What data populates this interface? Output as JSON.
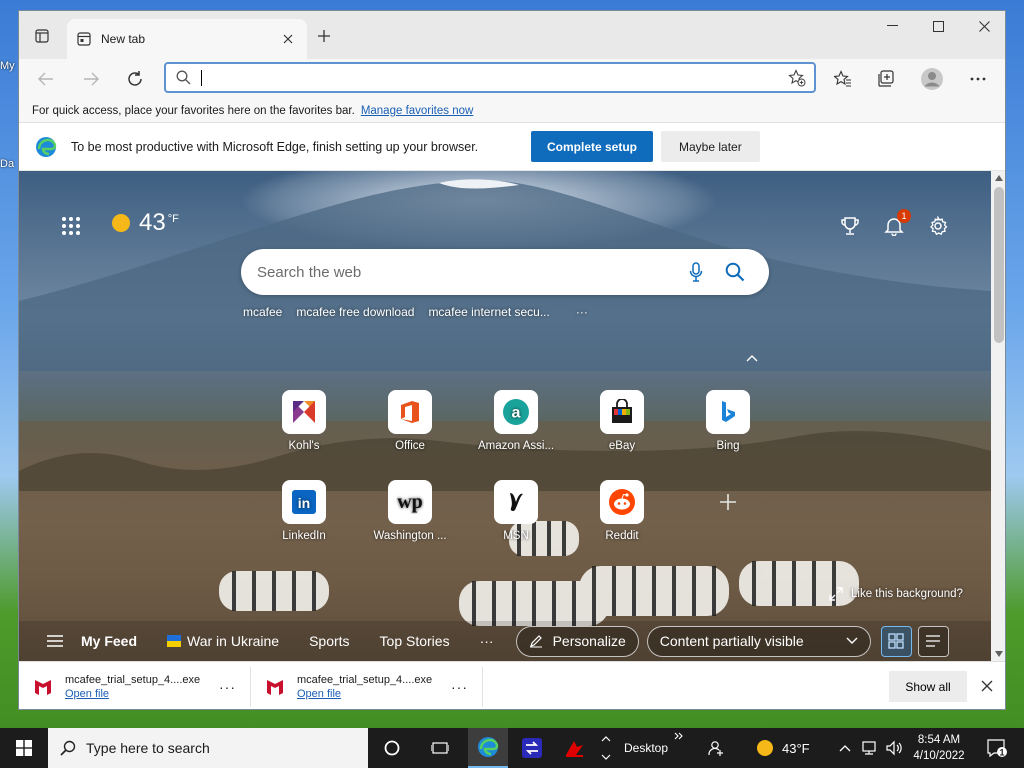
{
  "desktop": {
    "peek_top": "My",
    "peek_bottom": "Da"
  },
  "tab": {
    "title": "New tab"
  },
  "address": {
    "value": "",
    "placeholder": ""
  },
  "favbar": {
    "text": "For quick access, place your favorites here on the favorites bar.",
    "link": "Manage favorites now"
  },
  "setup": {
    "message": "To be most productive with Microsoft Edge, finish setting up your browser.",
    "primary": "Complete setup",
    "secondary": "Maybe later"
  },
  "weather": {
    "temp": "43",
    "unit": "°F"
  },
  "notifications": {
    "count": "1"
  },
  "search": {
    "placeholder": "Search the web",
    "suggestions": [
      "mcafee",
      "mcafee free download",
      "mcafee internet secu...",
      "···"
    ]
  },
  "tiles": [
    {
      "label": "Kohl's",
      "icon": "kohls-icon"
    },
    {
      "label": "Office",
      "icon": "office-icon"
    },
    {
      "label": "Amazon Assi...",
      "icon": "amazon-icon"
    },
    {
      "label": "eBay",
      "icon": "ebay-icon"
    },
    {
      "label": "Bing",
      "icon": "bing-icon"
    },
    {
      "label": "LinkedIn",
      "icon": "linkedin-icon"
    },
    {
      "label": "Washington ...",
      "icon": "washington-post-icon"
    },
    {
      "label": "MSN",
      "icon": "msn-icon"
    },
    {
      "label": "Reddit",
      "icon": "reddit-icon"
    }
  ],
  "background": {
    "like_label": "Like this background?"
  },
  "feed": {
    "my_feed": "My Feed",
    "items": [
      "War in Ukraine",
      "Sports",
      "Top Stories"
    ],
    "more": "···",
    "personalize": "Personalize",
    "visibility": "Content partially visible"
  },
  "downloads": {
    "items": [
      {
        "filename": "mcafee_trial_setup_4....exe",
        "action": "Open file"
      },
      {
        "filename": "mcafee_trial_setup_4....exe",
        "action": "Open file"
      }
    ],
    "more": "···",
    "show_all": "Show all"
  },
  "taskbar": {
    "search_placeholder": "Type here to search",
    "desktop_label": "Desktop",
    "weather": "43°F",
    "time": "8:54 AM",
    "date": "4/10/2022",
    "notification_count": "1"
  },
  "colors": {
    "accent": "#0f6cbd",
    "link": "#1a5fb4",
    "badge": "#d83b01"
  }
}
